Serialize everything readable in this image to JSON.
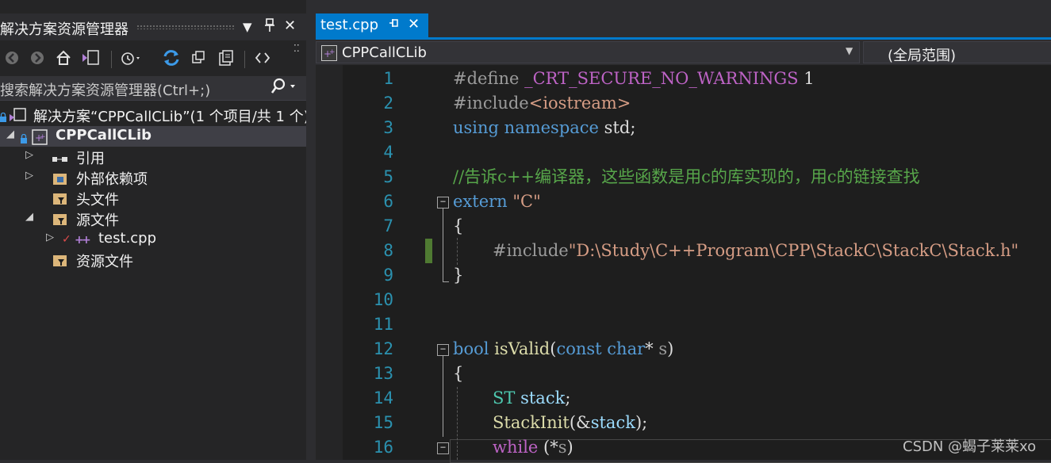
{
  "solution_explorer": {
    "title": "解决方案资源管理器",
    "title_buttons": {
      "dropdown": "▼",
      "pin": "🖈",
      "close": "✕"
    },
    "toolbar_icons": [
      "back-icon",
      "forward-icon",
      "home-icon",
      "switch-views-icon",
      "history-icon",
      "refresh-icon",
      "collapse-all-icon",
      "show-all-files-icon",
      "code-view-icon"
    ],
    "search_placeholder": "搜索解决方案资源管理器(Ctrl+;)",
    "tree": {
      "solution_label": "解决方案“CPPCallCLib”(1 个项目/共 1 个)",
      "project_label": "CPPCallCLib",
      "items": [
        {
          "label": "引用"
        },
        {
          "label": "外部依赖项"
        },
        {
          "label": "头文件"
        },
        {
          "label": "源文件"
        },
        {
          "label": "test.cpp"
        },
        {
          "label": "资源文件"
        }
      ]
    }
  },
  "editor_tab": {
    "label": "test.cpp"
  },
  "navbar": {
    "project": "CPPCallCLib",
    "scope": "(全局范围)"
  },
  "line_numbers": [
    "1",
    "2",
    "3",
    "4",
    "5",
    "6",
    "7",
    "8",
    "9",
    "10",
    "11",
    "12",
    "13",
    "14",
    "15",
    "16"
  ],
  "code": {
    "l1_a": "#define ",
    "l1_b": "_CRT_SECURE_NO_WARNINGS",
    "l1_c": " 1",
    "l2_a": "#include",
    "l2_b": "<iostream>",
    "l3_a": "using",
    "l3_b": " namespace",
    "l3_c": " std;",
    "l5": "//告诉c++编译器，这些函数是用c的库实现的，用c的链接查找",
    "l6_a": "extern",
    "l6_b": " \"C\"",
    "l7": "{",
    "l8_a": "#include",
    "l8_b": "\"D:\\Study\\C++Program\\CPP\\StackC\\StackC\\Stack.h\"",
    "l9": "}",
    "l12_a": "bool",
    "l12_b": " isValid",
    "l12_c": "(",
    "l12_d": "const",
    "l12_e": " char",
    "l12_f": "* ",
    "l12_g": "s",
    "l12_h": ")",
    "l13": "{",
    "l14_a": "ST",
    "l14_b": " stack",
    "l14_c": ";",
    "l15_a": "StackInit",
    "l15_b": "(&",
    "l15_c": "stack",
    "l15_d": ");",
    "l16_a": "while",
    "l16_b": " (*",
    "l16_c": "s",
    "l16_d": ")"
  },
  "watermark": "CSDN @蝎子莱莱xo",
  "colors": {
    "accent": "#007acc",
    "keyword": "#569cd6",
    "comment": "#57a64a",
    "string": "#d69d85",
    "type": "#4ec9b0",
    "function": "#dcdcaa",
    "macro": "#bd63c5"
  }
}
